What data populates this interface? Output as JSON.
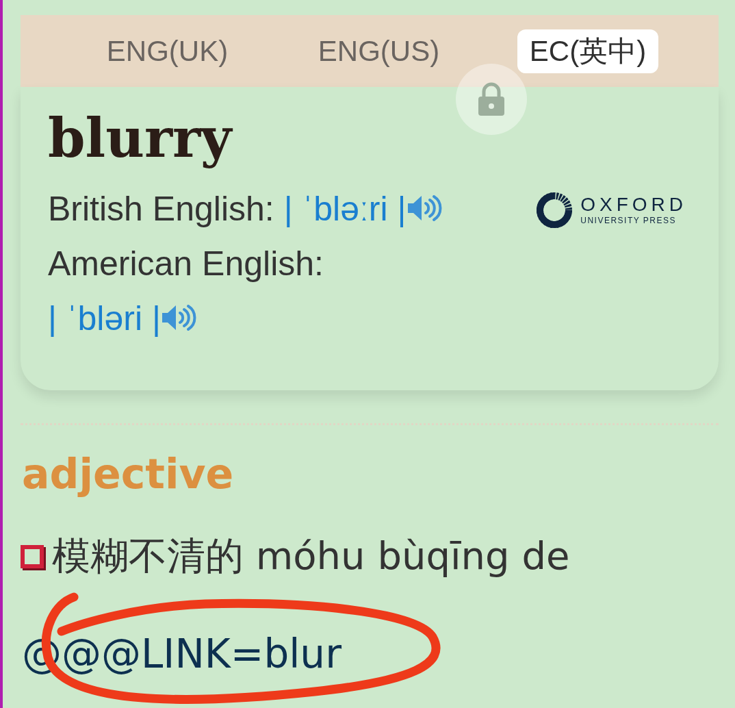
{
  "tabs": [
    {
      "label": "ENG(UK)",
      "selected": false
    },
    {
      "label": "ENG(US)",
      "selected": false
    },
    {
      "label": "EC(英中)",
      "selected": true
    }
  ],
  "entry": {
    "headword": "blurry",
    "pronunciations": [
      {
        "label": "British English:",
        "ipa": "| ˈbləːri |"
      },
      {
        "label": "American English:",
        "ipa": "| ˈbləri |"
      }
    ]
  },
  "publisher": {
    "name": "OXFORD",
    "subtitle": "UNIVERSITY PRESS"
  },
  "part_of_speech": "adjective",
  "definitions": [
    {
      "text": "模糊不清的 móhu bùqīng de"
    }
  ],
  "link": "@@@LINK=blur"
}
